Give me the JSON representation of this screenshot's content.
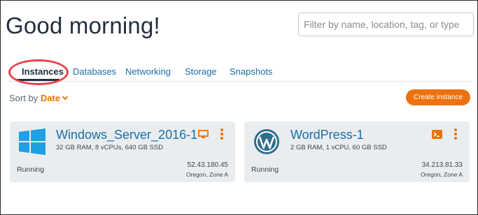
{
  "header": {
    "greeting": "Good morning!",
    "filter_placeholder": "Filter by name, location, tag, or type"
  },
  "tabs": [
    {
      "label": "Instances",
      "active": true
    },
    {
      "label": "Databases",
      "active": false
    },
    {
      "label": "Networking",
      "active": false
    },
    {
      "label": "Storage",
      "active": false
    },
    {
      "label": "Snapshots",
      "active": false
    }
  ],
  "toolbar": {
    "sort_label": "Sort by",
    "sort_value": "Date",
    "create_label": "Create instance"
  },
  "instances": [
    {
      "name": "Windows_Server_2016-1",
      "spec": "32 GB RAM, 8 vCPUs, 640 GB SSD",
      "status": "Running",
      "ip": "52.43.180.45",
      "zone": "Oregon, Zone A",
      "logo_icon": "windows-logo-icon",
      "connect_icon": "rdp-monitor-icon"
    },
    {
      "name": "WordPress-1",
      "spec": "2 GB RAM, 1 vCPU, 60 GB SSD",
      "status": "Running",
      "ip": "34.213.81.33",
      "zone": "Oregon, Zone A",
      "logo_icon": "wordpress-logo-icon",
      "connect_icon": "ssh-terminal-icon"
    }
  ],
  "colors": {
    "accent": "#ec7211",
    "link": "#1a6fa8",
    "highlight_circle": "#e8434c",
    "card_bg": "#eaedf0",
    "text": "#232f3e"
  }
}
